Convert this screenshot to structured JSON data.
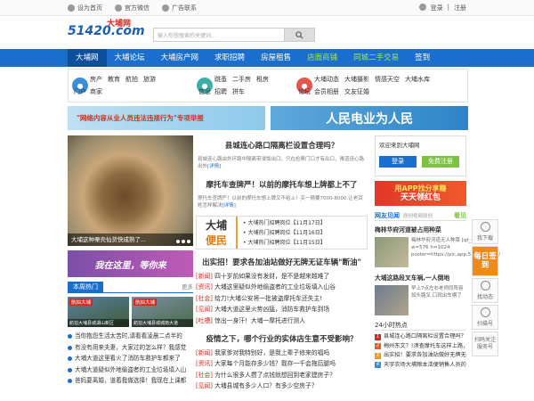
{
  "topbar": {
    "set_home": "设为首页",
    "wechat": "官方微信",
    "ad_contact": "广告联系",
    "login": "登录",
    "sep": "|",
    "register": "注册"
  },
  "header": {
    "logo_main": "51420.com",
    "logo_sub": "大埔网",
    "search_placeholder": "输入你想搜索的关键词...",
    "search_button_icon": "search-icon"
  },
  "nav": {
    "items": [
      "大埔网",
      "大埔论坛",
      "大埔房产网",
      "求职招聘",
      "房屋租售",
      "店面商铺",
      "同城二手交易",
      "签到"
    ]
  },
  "subnav": {
    "groups": [
      {
        "name": "门户",
        "color": "#3a8fd8",
        "links": [
          "房产",
          "教育",
          "航拍",
          "旅游",
          "商家"
        ]
      },
      {
        "name": "信息",
        "color": "#3ab0a8",
        "links": [
          "跳蚤",
          "二手房",
          "租房",
          "招聘",
          "拼车"
        ]
      },
      {
        "name": "论坛",
        "color": "#e2574c",
        "links": [
          "大埔动态",
          "大埔摄影",
          "情感天空",
          "大埔水库",
          "会员相册",
          "交友征婚"
        ]
      }
    ]
  },
  "banners": {
    "left": "\"网络内容从业人员违法违规行为\"专项举报",
    "right": "人民电业为人民"
  },
  "col1": {
    "photo_caption": "大埔这种栗壳仙货快成熟了...",
    "ad_text": "我在这里，等你来",
    "section_title": "本周热门",
    "section_more": "更多",
    "thumbs": [
      {
        "label": "航拍大埔",
        "caption": "航拍大埔县城湖山新区"
      },
      {
        "label": "航拍大埔",
        "caption": "航拍大埔县城城南大道"
      }
    ],
    "list": [
      "当你抱怨生活太苦时,请看看凌晨二点半的",
      "有没有用来夫妻，大家过的怎么样？我感觉",
      "大埔大道这里看火了消防车救护车都来了",
      "大埔大道疑似外地偷盗者的工业垃圾填入山",
      "爸妈要离婚，道着我做选择！我现在上课都"
    ]
  },
  "col2": {
    "headline1": "县城连心路口隔离栏设置合理吗？",
    "summary1": "县城连心路由外环路中隔离带浸饭出口，只在检察门口才有出口，难道连心路出外",
    "more": "[详情]",
    "headline2": "摩托车查牌严！以前的摩托车想上牌都上不了",
    "summary2": "摩托车查牌严！以前的摩托车想上牌又不给上！买一辆要7000-8000.让老百姓怎样解决",
    "jobs_a": "大埔",
    "jobs_b": "便民",
    "jobs": [
      "大埔热门招聘岗位【11月17日】",
      "大埔热门招聘岗位【11月16日】",
      "大埔热门招聘岗位【11月15日】"
    ],
    "headline3": "出实招！要求各加油站做好无牌无证车辆\"断油\"",
    "news": [
      {
        "tag": "[新闻]",
        "text": " 四十岁前如果没有发财，是不是越来越难了"
      },
      {
        "tag": "[资讯]",
        "text": " 大埔这里疑似外地偷盗者的工业垃圾填入山谷"
      },
      {
        "tag": "[社会]",
        "text": " 给力!大埔公安将一批被盗摩托车还失主!"
      },
      {
        "tag": "[见闻]",
        "text": " 大埔大道这里火势凶猛，消防车救护车到场"
      },
      {
        "tag": "[吐槽]",
        "text": " 惊出一身汗！大埔一摩托进行测人"
      }
    ],
    "headline4": "疫情之下，哪个行业的实体店生意不受影响？",
    "news2": [
      {
        "tag": "[新闻]",
        "text": " 我家爹对我特别好，是我上辈子修来的福吗"
      },
      {
        "tag": "[资讯]",
        "text": " 大家每个月能存多少钱？我存一千会拖后腿吗"
      },
      {
        "tag": "[社会]",
        "text": " 为什么很多人攒了点钱就想回到老家建房子？"
      },
      {
        "tag": "[见闻]",
        "text": " 大埔县城有多少人口？有多少空房子？"
      }
    ]
  },
  "col3": {
    "welcome": "欢迎来到大埔网",
    "login_btn": "登录",
    "reg_btn": "免费注册",
    "ad_line1": "用APP找分享赚",
    "ad_line2": "天天领红包",
    "bar_title": "网友见闻",
    "bar_sub": "原创视频原创",
    "bar_tag": "看见",
    "item_title": "梅林华府河道被占用种菜",
    "item_text": "梅林华府河道无人种菜 [qf_video w=576 h=1024 poster=https://pic.app.514200.com/",
    "item2_title": "大埔这路段叉车祸,一人倒地",
    "item2_text": "早上7点左右老师同阵容如头路叉 口就出车祸了",
    "hot_title": "24小时热点",
    "hot": [
      "县城连心路口隔离栏设置合理吗？",
      "梅州东文？!须查摩托车这样上路，有",
      "出实招！要求各加油站做好无牌无证车",
      "天宇农场大埔粮本活便销售人员的通"
    ],
    "hot_colors": [
      "#d9261c",
      "#e85c1c",
      "#f09a1c",
      "#3a8fd8"
    ]
  },
  "side": {
    "items": [
      "我下载",
      "每日签到",
      "找动态",
      "扫描号",
      "扫码关注\n服务号"
    ]
  },
  "colors": {
    "nav_blue": "#1a6fce",
    "nav_active": "#0e4f9c",
    "green_btn": "#7cc242",
    "login_btn": "#1a6fce",
    "red": "#d9261c",
    "orange": "#f08a1c"
  }
}
